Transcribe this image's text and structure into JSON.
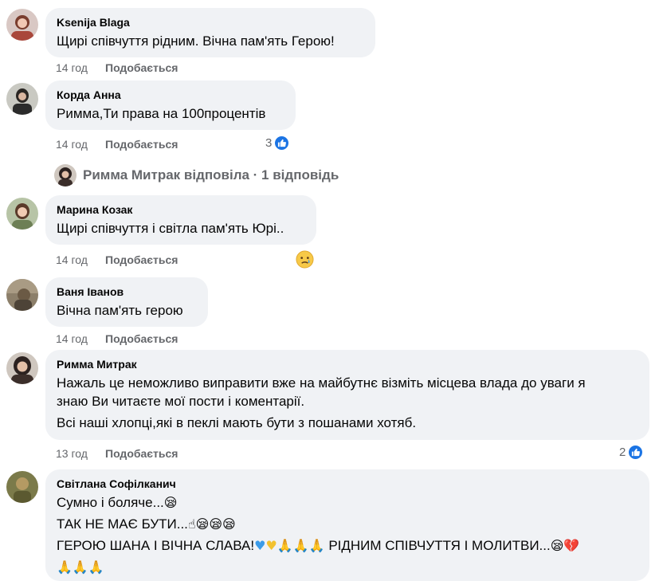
{
  "comments": [
    {
      "author": "Ksenija Blaga",
      "lines": [
        "Щирі співчуття рідним. Вічна пам'ять Герою!"
      ],
      "time": "14 год",
      "like": "Подобається"
    },
    {
      "author": "Корда Анна",
      "lines": [
        "Римма,Ти права на 100процентів"
      ],
      "time": "14 год",
      "like": "Подобається",
      "reaction_count": "3"
    },
    {
      "author": "Марина Козак",
      "lines": [
        "Щирі співчуття і світла пам'ять Юрі.."
      ],
      "time": "14 год",
      "like": "Подобається"
    },
    {
      "author": "Ваня Іванов",
      "lines": [
        "Вічна пам'ять герою"
      ],
      "time": "14 год",
      "like": "Подобається"
    },
    {
      "author": "Римма Митрак",
      "lines": [
        "Нажаль це неможливо виправити вже на майбутнє візміть місцева влада до уваги я",
        "знаю Ви читаєте мої пости і коментарії.",
        "Всі наші хлопці,які в пеклі мають бути з пошанами хотяб."
      ],
      "time": "13 год",
      "like": "Подобається",
      "reaction_count": "2"
    },
    {
      "author": "Світлана Софілканич",
      "lines": [
        "Сумно і боляче...",
        "ТАК НЕ МАЄ БУТИ...",
        "ГЕРОЮ ШАНА І ВІЧНА СЛАВА!",
        "РІДНИМ СПІВЧУТТЯ І МОЛИТВИ..."
      ]
    }
  ],
  "reply_summary": "Римма Митрак відповіла · 1 відповідь",
  "icons": {
    "like": "like-thumb-icon",
    "sad": "sad-face-icon",
    "emoji_names": [
      "sleepy-face",
      "index-pointing-up",
      "blue-heart",
      "yellow-heart",
      "folded-hands",
      "broken-heart"
    ]
  },
  "colors": {
    "bubble": "#f0f2f5",
    "meta": "#65676b",
    "like_blue": "#1b74e4"
  }
}
